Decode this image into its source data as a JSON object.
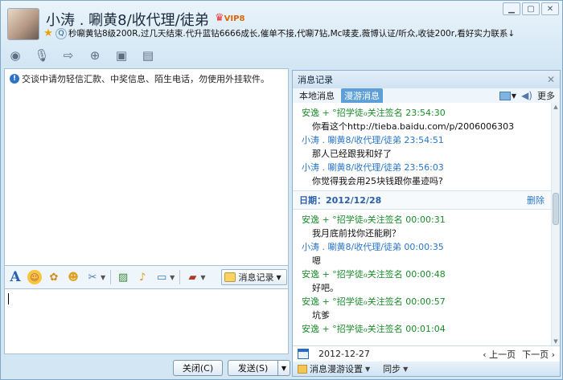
{
  "header": {
    "nickname": "小涛 . 唰黄8/收代理/徒弟",
    "vip_badge": "VIP8",
    "signature": "秒唰黄钻8级200R,过几天结束.代升蓝钻6666成长,催单不接,代唰7钻,Mc唛麦,薇博认证/听众,收徒200r,看好实力联系↓"
  },
  "window_controls": [
    "minimize",
    "maximize",
    "close"
  ],
  "toolbar_icons": [
    "video-call-icon",
    "voice-call-icon",
    "send-file-icon",
    "create-group-icon",
    "remote-assist-icon",
    "apps-icon"
  ],
  "chat": {
    "warning": "交谈中请勿轻信汇款、中奖信息、陌生电话，勿使用外挂软件。"
  },
  "format_toolbar": {
    "record_button": "消息记录"
  },
  "buttons": {
    "close": "关闭(C)",
    "send": "发送(S)"
  },
  "history": {
    "title": "消息记录",
    "tabs": [
      "本地消息",
      "漫游消息"
    ],
    "more": "更多",
    "messages_before": [
      {
        "sender": "安逸 + °招学徒ℴ关注签名",
        "time": "23:54:30",
        "text": "你看这个http://tieba.baidu.com/p/2006006303",
        "color": "green"
      },
      {
        "sender": "小涛 . 唰黄8/收代理/徒弟",
        "time": "23:54:51",
        "text": "那人已经跟我和好了",
        "color": "blue"
      },
      {
        "sender": "小涛 . 唰黄8/收代理/徒弟",
        "time": "23:56:03",
        "text": "你觉得我会用25块钱跟你墨迹吗?",
        "color": "blue"
      }
    ],
    "date_label": "日期：2012/12/28",
    "delete_label": "删除",
    "messages_after": [
      {
        "sender": "安逸 + °招学徒ℴ关注签名",
        "time": "00:00:31",
        "text": "我月底前找你还能刷？",
        "color": "green"
      },
      {
        "sender": "小涛 . 唰黄8/收代理/徒弟",
        "time": "00:00:35",
        "text": "嗯",
        "color": "blue"
      },
      {
        "sender": "安逸 + °招学徒ℴ关注签名",
        "time": "00:00:48",
        "text": "好吧。",
        "color": "green"
      },
      {
        "sender": "安逸 + °招学徒ℴ关注签名",
        "time": "00:00:57",
        "text": "坑爹",
        "color": "green"
      },
      {
        "sender": "安逸 + °招学徒ℴ关注签名",
        "time": "00:01:04",
        "text": "",
        "color": "green"
      }
    ],
    "nav": {
      "date": "2012-12-27",
      "prev": "上一页",
      "next": "下一页"
    },
    "footer": {
      "roaming_settings": "消息漫游设置",
      "sync": "同步"
    }
  }
}
